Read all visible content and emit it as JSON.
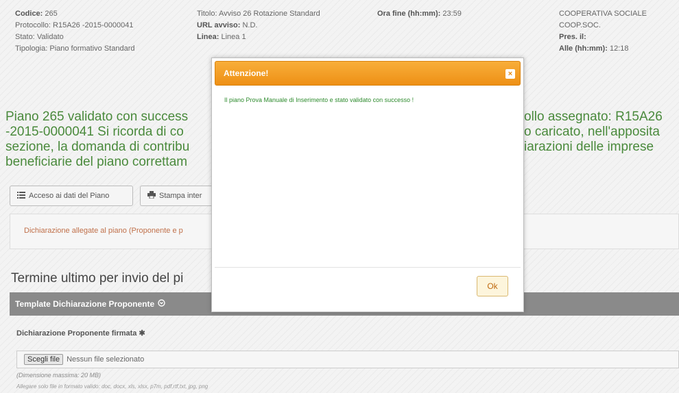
{
  "header": {
    "codice": {
      "label": "Codice:",
      "value": "265"
    },
    "protocollo": {
      "label": "Protocollo:",
      "value": "R15A26 -2015-0000041"
    },
    "stato": {
      "label": "Stato:",
      "value": "Validato"
    },
    "tipologia": {
      "label": "Tipologia:",
      "value": "Piano formativo Standard"
    },
    "titolo": {
      "label": "Titolo:",
      "value": "Avviso 26 Rotazione Standard"
    },
    "url_avviso": {
      "label": "URL avviso:",
      "value": "N.D."
    },
    "linea": {
      "label": "Linea:",
      "value": "Linea 1"
    },
    "ora_fine": {
      "label": "Ora fine (hh:mm):",
      "value": "23:59"
    },
    "ente_line1": "COOPERATIVA SOCIALE",
    "ente_line2": "COOP.SOC.",
    "pres": {
      "label": "Pres. il:",
      "value": ""
    },
    "alle": {
      "label": "Alle (hh:mm):",
      "value": "12:18"
    }
  },
  "message": {
    "line1_left": "Piano 265 validato con success",
    "line1_right": "ollo assegnato: R15A26",
    "line2_left": "-2015-0000041 Si ricorda di co",
    "line2_right": "o caricato, nell'apposita",
    "line3_left": "sezione, la domanda di contribu",
    "line3_right": "iarazioni delle imprese",
    "line4_left": "beneficiarie del piano correttam"
  },
  "buttons": {
    "data_access": "Acceso ai dati del Piano",
    "print": "Stampa inter"
  },
  "alert": {
    "text": "Dichiarazione allegate al piano (Proponente e p"
  },
  "deadline": {
    "text": "Termine ultimo per invio del pi"
  },
  "panel": {
    "title": "Template Dichiarazione Proponente"
  },
  "upload": {
    "label": "Dichiarazione Proponente firmata",
    "file_button": "Scegli file",
    "file_status": "Nessun file selezionato",
    "max_size": "(Dimensione massima: 20 MB)",
    "formats": "Allegare solo file in formato valido: doc, docx, xls, xlsx, p7m, pdf,rtf,txt, jpg, png"
  },
  "modal": {
    "title": "Attenzione!",
    "close": "×",
    "message": "Il piano Prova Manuale di Inserimento e stato validato con successo !",
    "ok": "Ok"
  },
  "icons": {
    "list": "list-icon",
    "print": "printer-icon",
    "info": "info-circle-icon",
    "required": "asterisk-icon",
    "close": "close-icon"
  },
  "colors": {
    "success_text": "#4a8a3c",
    "modal_header": "#ee9015",
    "panel_header": "#8a8a8a",
    "alert_text": "#c0704a"
  }
}
